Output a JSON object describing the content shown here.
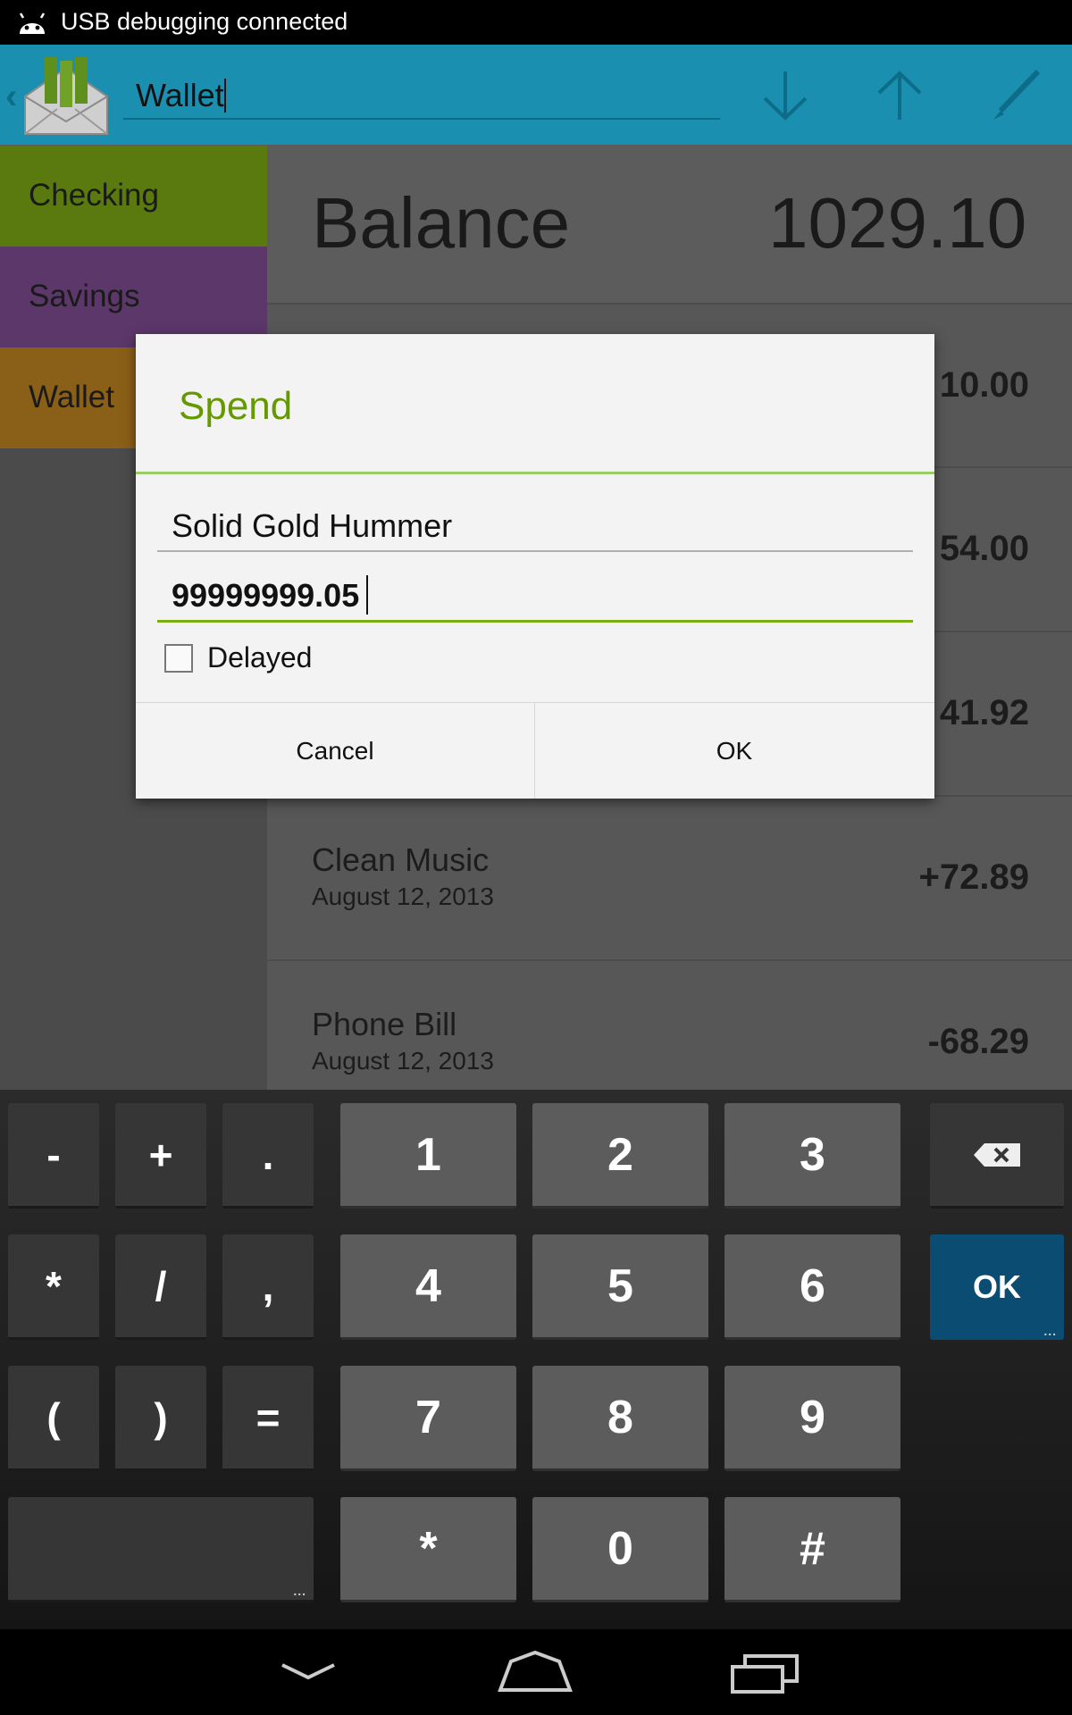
{
  "status_bar": {
    "text": "USB debugging connected"
  },
  "action_bar": {
    "account_value": "Wallet"
  },
  "sidebar": {
    "items": [
      {
        "label": "Checking",
        "color": "#5a7a10"
      },
      {
        "label": "Savings",
        "color": "#5c3769"
      },
      {
        "label": "Wallet",
        "color": "#8a5f18"
      }
    ]
  },
  "main": {
    "balance_label": "Balance",
    "balance_value": "1029.10",
    "transactions": [
      {
        "name": "",
        "date": "",
        "amount": "10.00"
      },
      {
        "name": "",
        "date": "",
        "amount": "54.00"
      },
      {
        "name": "",
        "date": "",
        "amount": "41.92"
      },
      {
        "name": "Clean Music",
        "date": "August 12, 2013",
        "amount": "+72.89"
      },
      {
        "name": "Phone Bill",
        "date": "August 12, 2013",
        "amount": "-68.29"
      }
    ]
  },
  "dialog": {
    "title": "Spend",
    "name_value": "Solid Gold Hummer",
    "amount_value": "99999999.05",
    "delayed_label": "Delayed",
    "delayed_checked": false,
    "cancel_label": "Cancel",
    "ok_label": "OK",
    "accent_color": "#669900"
  },
  "keyboard": {
    "symbol_keys": [
      "-",
      "+",
      ".",
      "*",
      "/",
      ",",
      "(",
      ")",
      "="
    ],
    "number_keys": [
      "1",
      "2",
      "3",
      "4",
      "5",
      "6",
      "7",
      "8",
      "9",
      "*",
      "0",
      "#"
    ],
    "ok_label": "OK",
    "more_indicator": "..."
  }
}
